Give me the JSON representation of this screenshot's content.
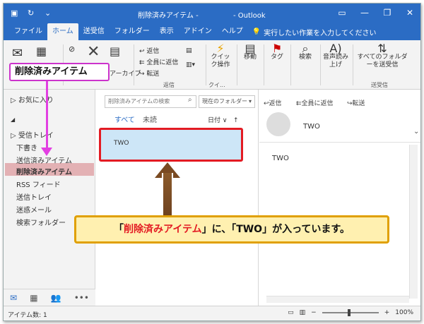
{
  "titlebar": {
    "title": "削除済みアイテム -",
    "app": "- Outlook",
    "minimize": "—",
    "restore": "❐",
    "close": "✕"
  },
  "tabs": [
    {
      "label": "ファイル"
    },
    {
      "label": "ホーム",
      "active": true
    },
    {
      "label": "送受信"
    },
    {
      "label": "フォルダー"
    },
    {
      "label": "表示"
    },
    {
      "label": "アドイン"
    },
    {
      "label": "ヘルプ"
    }
  ],
  "tellme": "実行したい作業を入力してください",
  "ribbon": {
    "cam_label": "アーカイブ",
    "reply": "返信",
    "reply_all": "全員に返信",
    "forward": "転送",
    "respond_group": "返信",
    "quick_steps": "クイック操作",
    "quick_group": "クイ...",
    "move": "移動",
    "tags": "タグ",
    "search": "検索",
    "read_aloud": "音声読み上げ",
    "send_receive_all": "すべてのフォルダーを送受信",
    "send_receive_group": "送受信"
  },
  "callout_folder": "削除済みアイテム",
  "folder_pane": {
    "favorites": "お気に入り",
    "items": [
      "受信トレイ",
      "下書き",
      "送信済みアイテム",
      "削除済みアイテム",
      "RSS フィード",
      "送信トレイ",
      "迷惑メール",
      "検索フォルダー"
    ]
  },
  "message_list": {
    "search_placeholder": "削除済みアイテムの検索",
    "scope": "現在のフォルダー",
    "filter_all": "すべて",
    "filter_unread": "未読",
    "sort": "日付 ∨",
    "sort_dir": "↑",
    "message_sender": "TWO"
  },
  "reading_pane": {
    "reply": "返信",
    "reply_all": "全員に返信",
    "forward": "転送",
    "sender": "TWO",
    "body": "TWO"
  },
  "callout_main": {
    "p1": "「",
    "p2": "削除済みアイテム",
    "p3": "」に、「TWO」が入っています。"
  },
  "statusbar": {
    "count": "アイテム数: 1",
    "zoom": "100%",
    "minus": "−",
    "plus": "+"
  }
}
